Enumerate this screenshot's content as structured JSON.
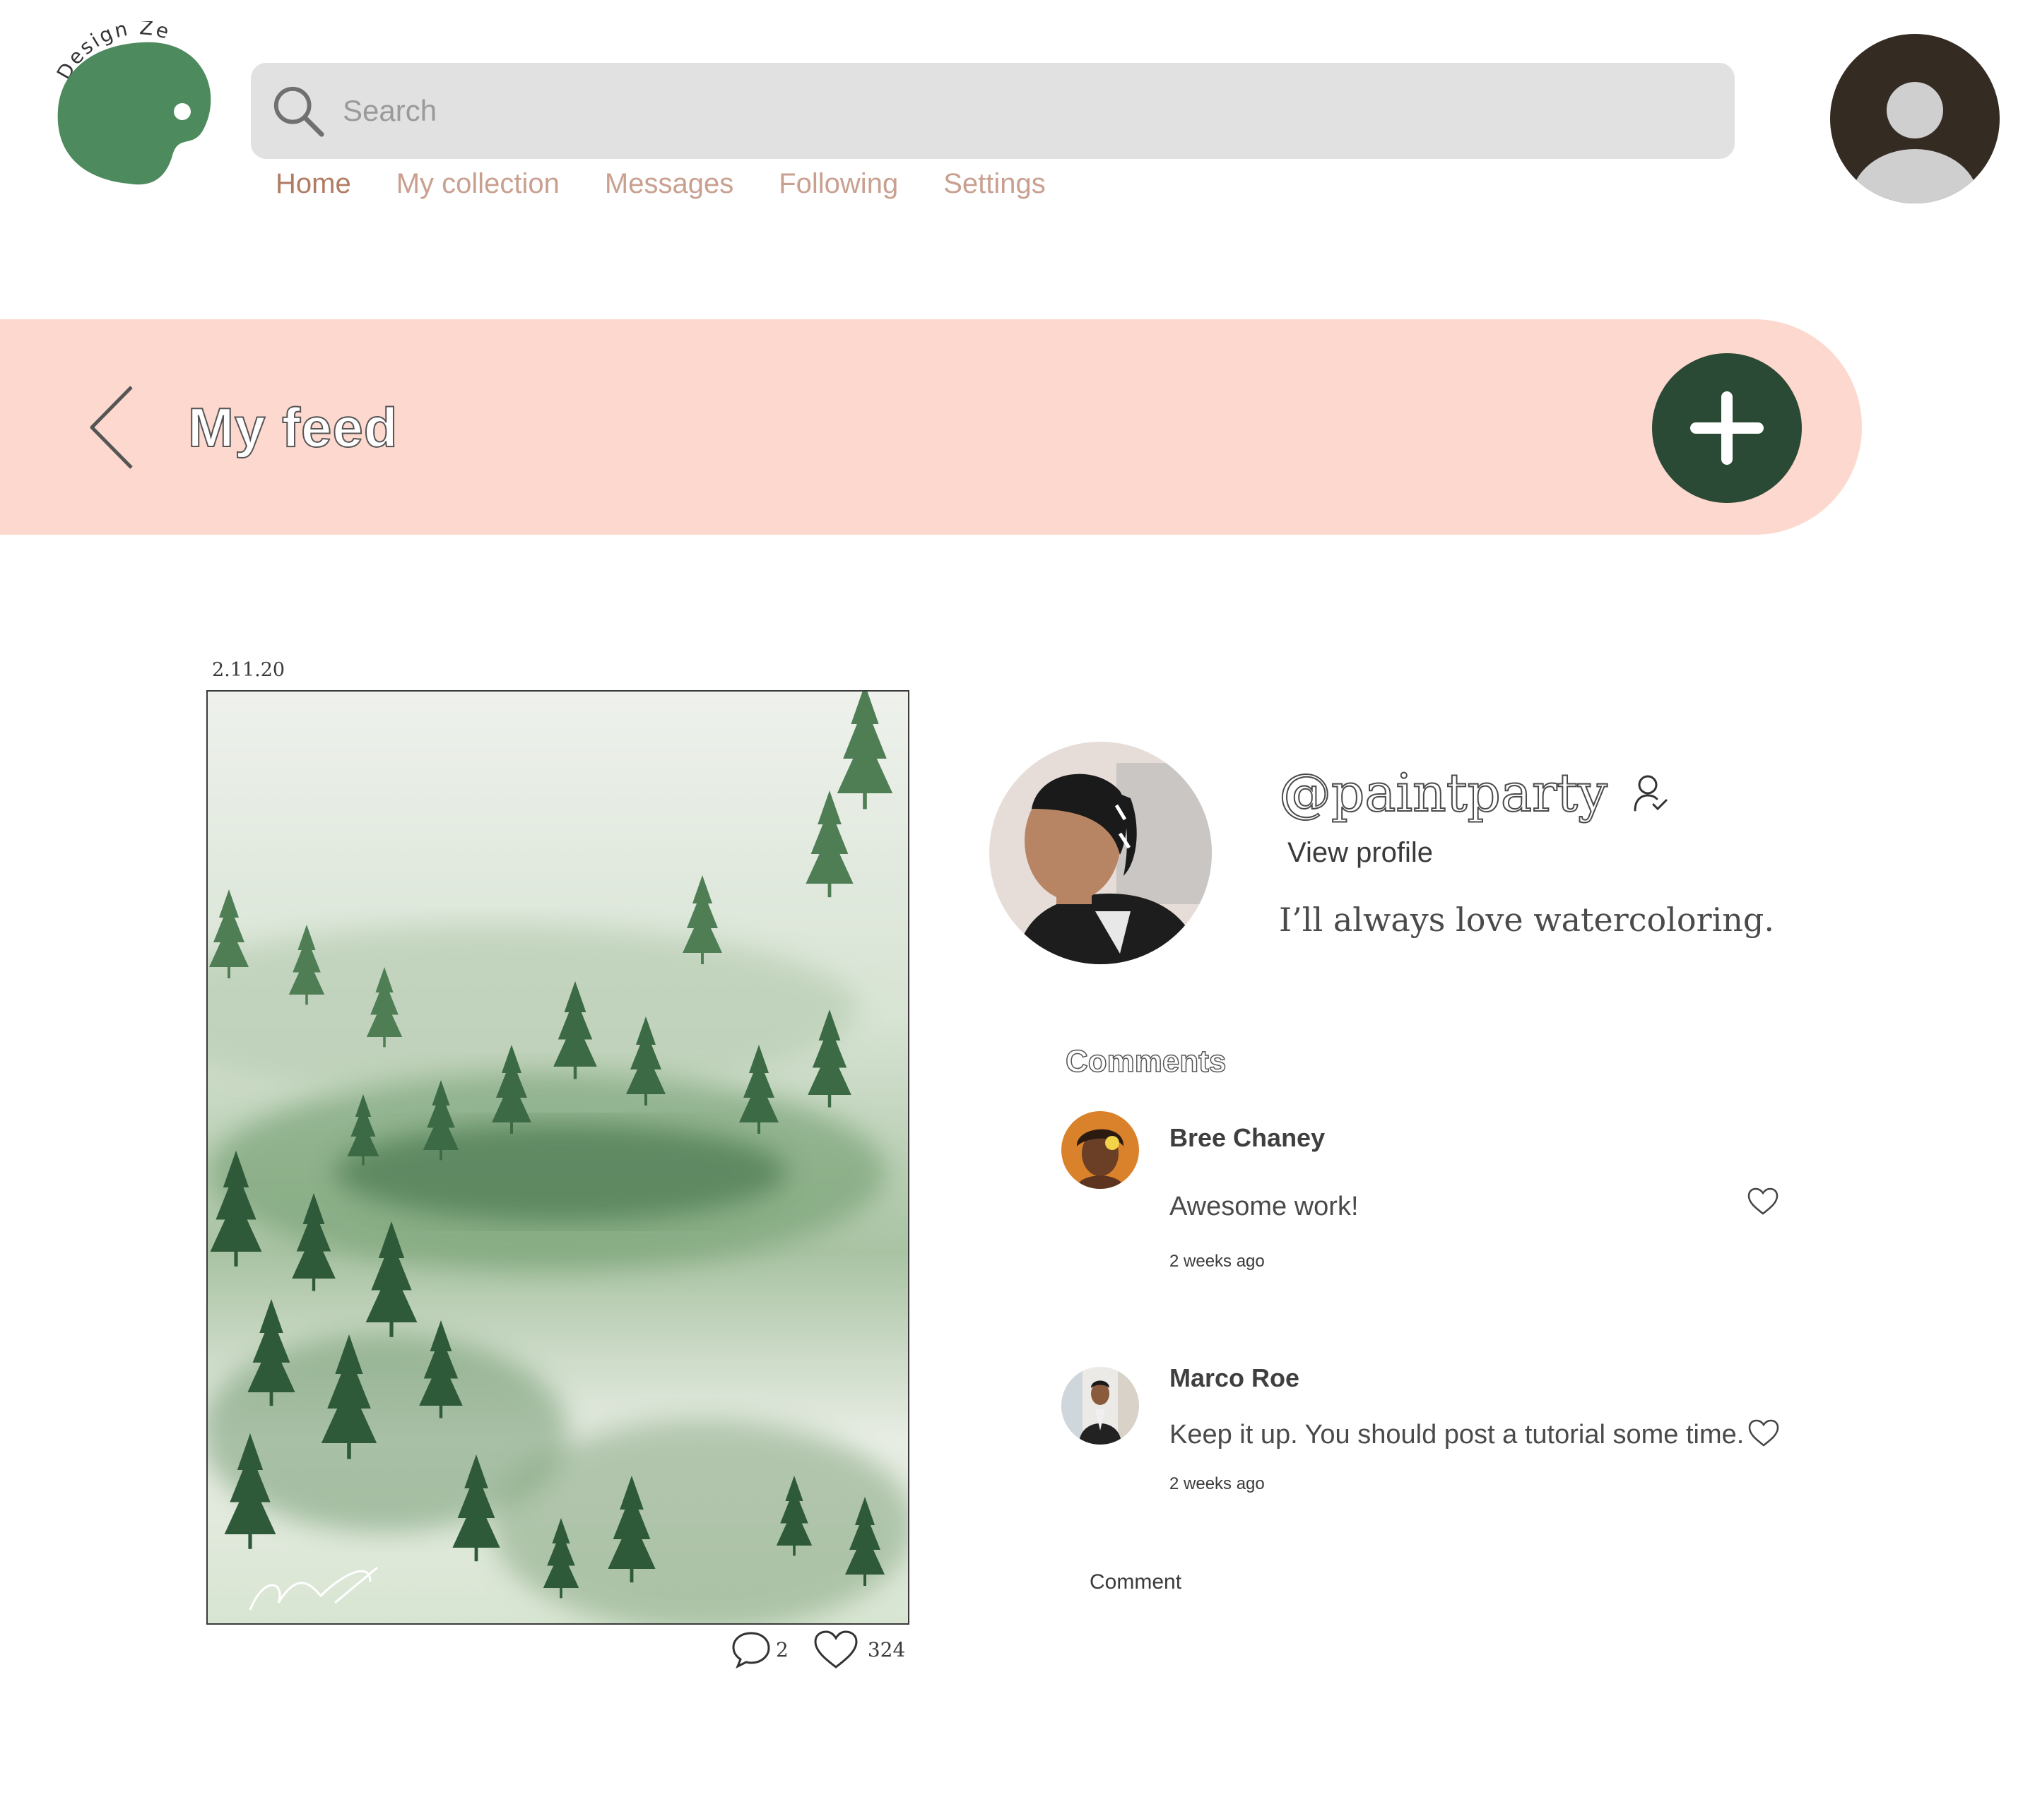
{
  "brand": {
    "logo_text": "Design Zen"
  },
  "search": {
    "placeholder": "Search"
  },
  "nav": {
    "items": [
      "Home",
      "My collection",
      "Messages",
      "Following",
      "Settings"
    ],
    "active": "Home"
  },
  "banner": {
    "title": "My feed"
  },
  "post": {
    "date": "2.11.20",
    "comment_count": "2",
    "like_count": "324"
  },
  "profile": {
    "handle": "@paintparty",
    "view_profile": "View profile",
    "bio": "I’ll always love watercoloring."
  },
  "comments": {
    "title": "Comments",
    "items": [
      {
        "name": "Bree Chaney",
        "text": "Awesome work!",
        "time": "2 weeks ago"
      },
      {
        "name": "Marco Roe",
        "text": "Keep it up. You should post a tutorial some time.",
        "time": "2 weeks ago"
      }
    ],
    "input_placeholder": "Comment"
  },
  "colors": {
    "banner": "#fdd8ce",
    "brand_green": "#4d8a5d",
    "add_button": "#2b4a35",
    "nav_active": "#b17c63",
    "nav_inactive": "#c9a090"
  }
}
